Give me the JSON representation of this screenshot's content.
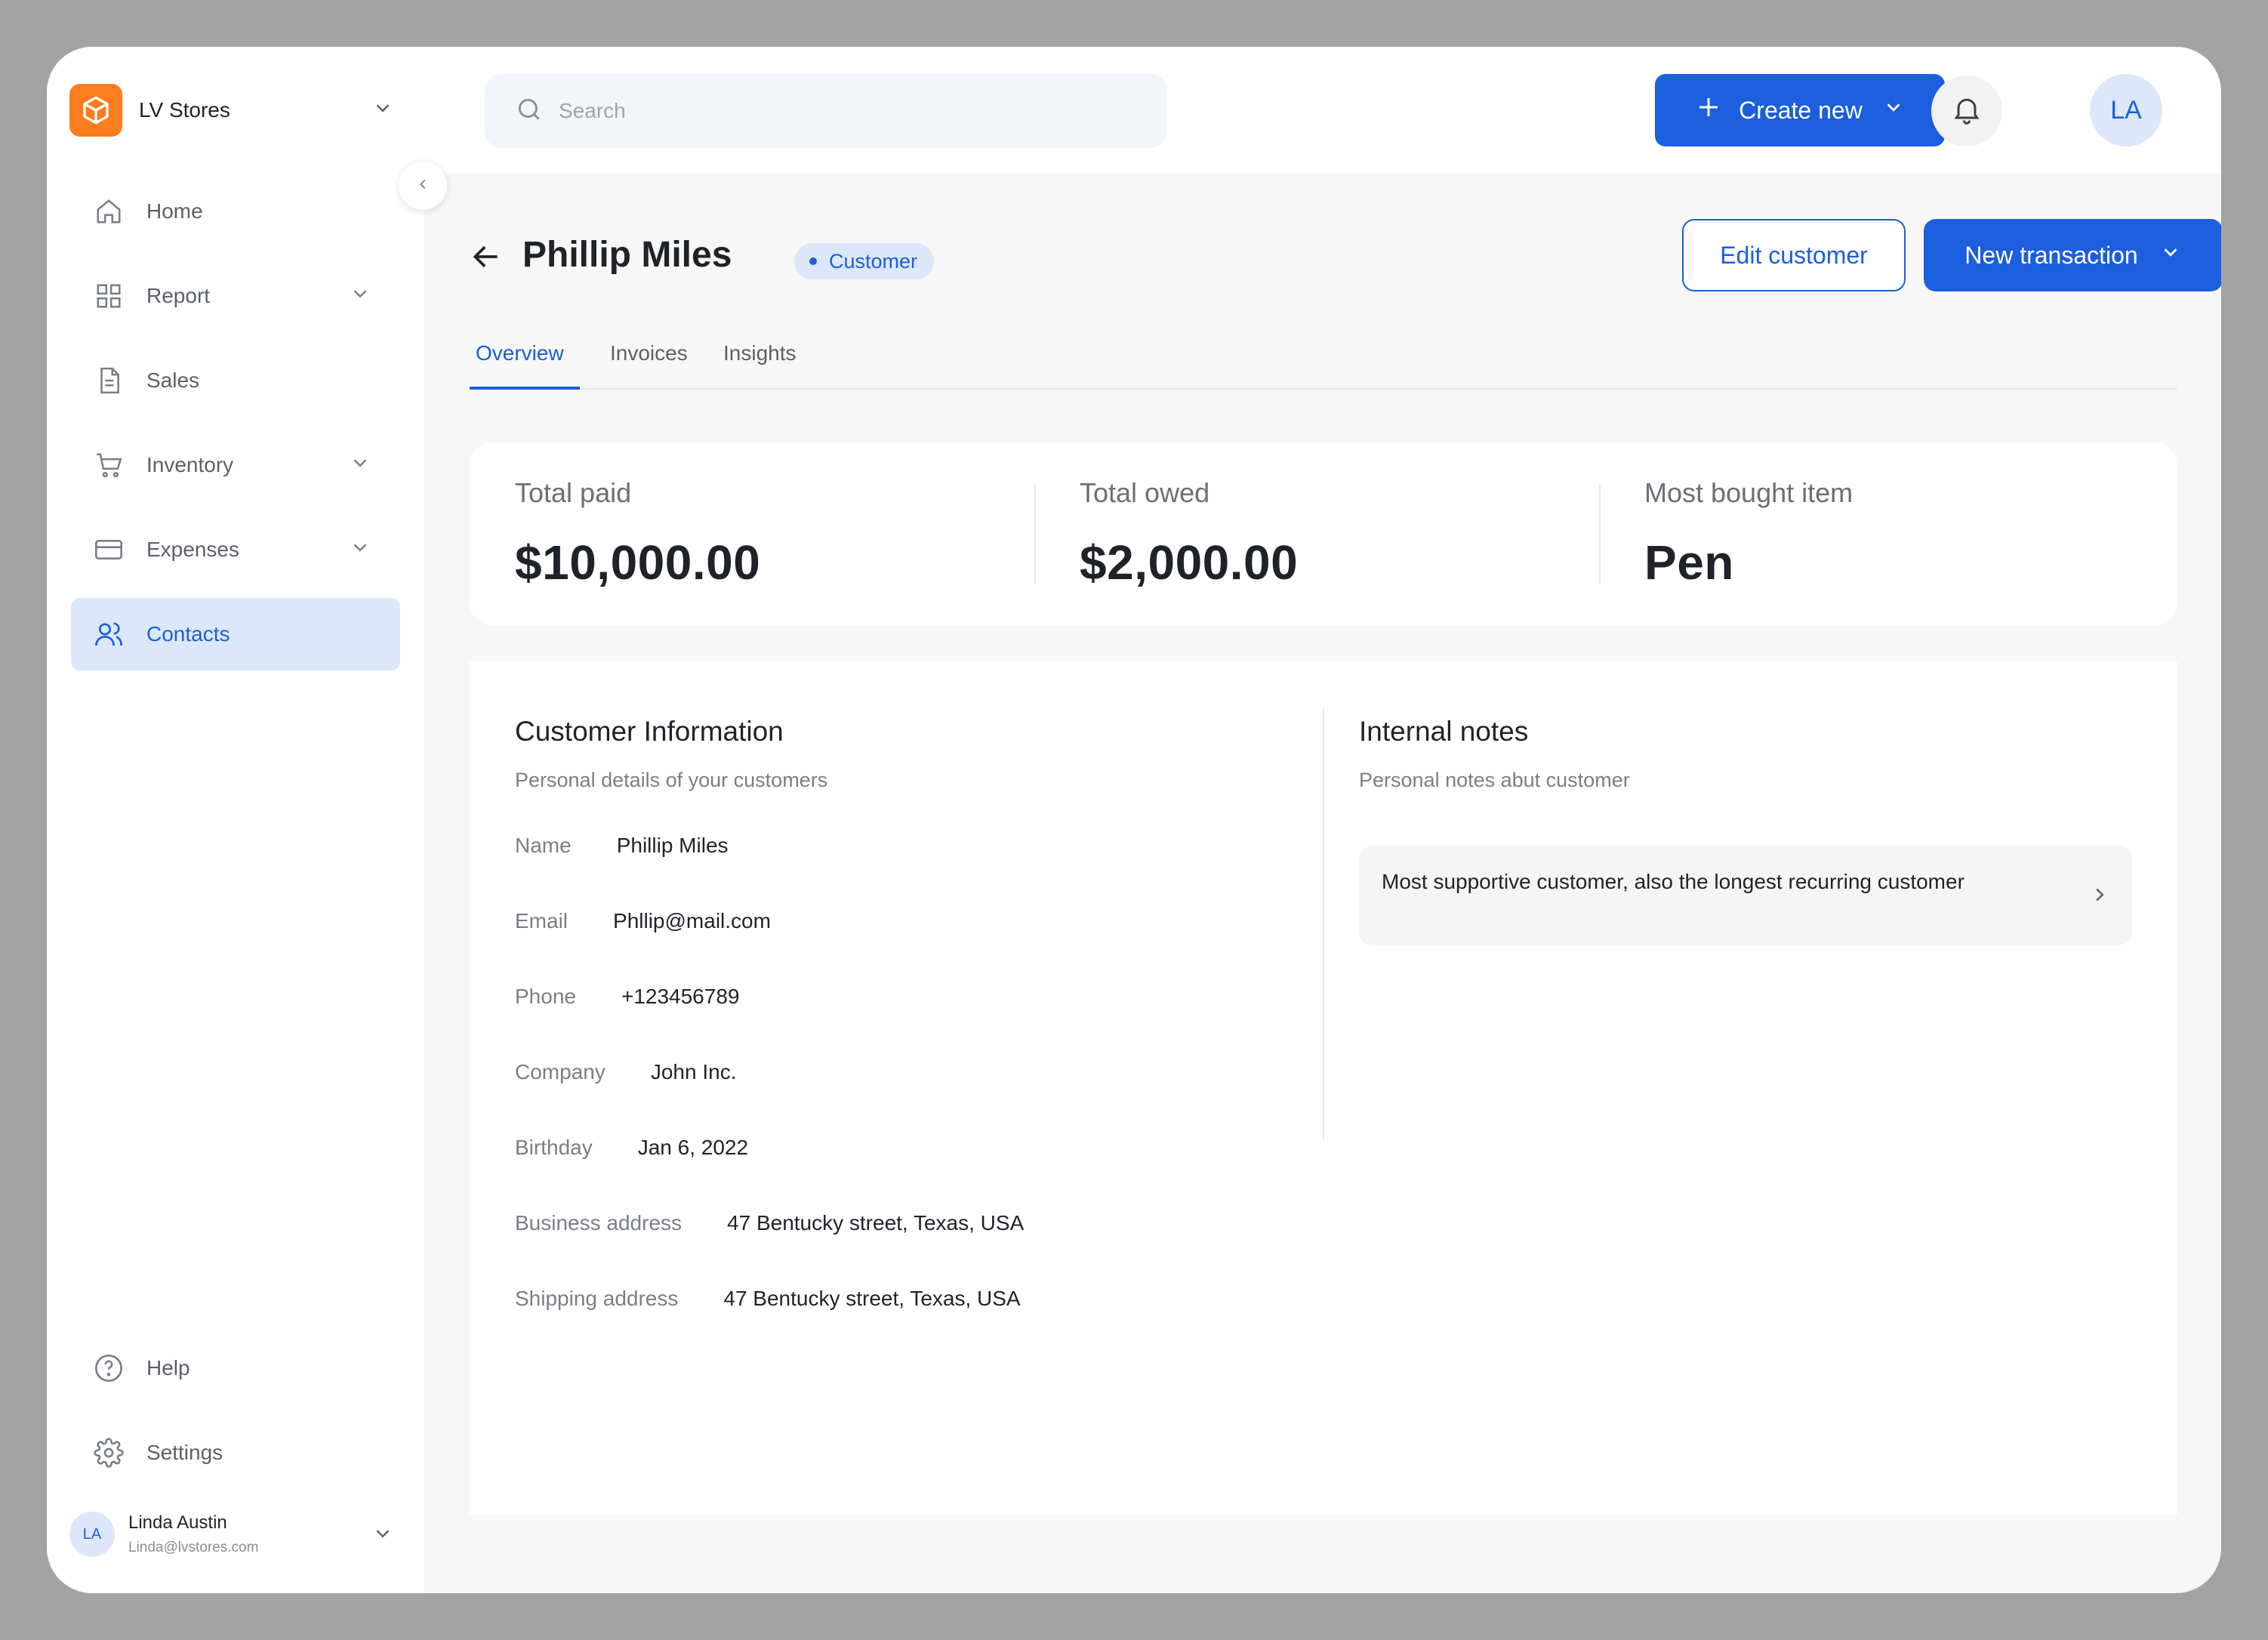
{
  "brand": {
    "name": "LV Stores"
  },
  "sidebar": {
    "items": [
      {
        "label": "Home",
        "icon": "home-icon"
      },
      {
        "label": "Report",
        "icon": "grid-icon",
        "expandable": true
      },
      {
        "label": "Sales",
        "icon": "document-icon"
      },
      {
        "label": "Inventory",
        "icon": "cart-icon",
        "expandable": true
      },
      {
        "label": "Expenses",
        "icon": "credit-card-icon",
        "expandable": true
      },
      {
        "label": "Contacts",
        "icon": "users-icon",
        "active": true
      }
    ],
    "bottom": [
      {
        "label": "Help",
        "icon": "help-circle-icon"
      },
      {
        "label": "Settings",
        "icon": "gear-icon"
      }
    ],
    "user": {
      "initials": "LA",
      "name": "Linda Austin",
      "email": "Linda@lvstores.com"
    }
  },
  "topbar": {
    "search_placeholder": "Search",
    "create_label": "Create new",
    "avatar_initials": "LA"
  },
  "page": {
    "title": "Phillip Miles",
    "badge": "Customer",
    "edit_label": "Edit customer",
    "new_transaction_label": "New transaction",
    "tabs": [
      {
        "label": "Overview",
        "active": true
      },
      {
        "label": "Invoices"
      },
      {
        "label": "Insights"
      }
    ]
  },
  "stats": [
    {
      "label": "Total paid",
      "value": "$10,000.00"
    },
    {
      "label": "Total owed",
      "value": "$2,000.00"
    },
    {
      "label": "Most bought item",
      "value": "Pen"
    }
  ],
  "customer_info": {
    "title": "Customer Information",
    "subtitle": "Personal details of your customers",
    "rows": [
      {
        "key": "Name",
        "value": "Phillip Miles"
      },
      {
        "key": "Email",
        "value": "Phllip@mail.com"
      },
      {
        "key": "Phone",
        "value": "+123456789"
      },
      {
        "key": "Company",
        "value": "John Inc."
      },
      {
        "key": "Birthday",
        "value": "Jan 6, 2022"
      },
      {
        "key": "Business address",
        "value": "47 Bentucky street, Texas, USA"
      },
      {
        "key": "Shipping address",
        "value": "47 Bentucky street, Texas, USA"
      }
    ]
  },
  "internal_notes": {
    "title": "Internal notes",
    "subtitle": "Personal notes abut customer",
    "note": "Most supportive customer, also the longest recurring customer"
  },
  "colors": {
    "accent": "#1b5ede",
    "accent_light": "#dde7fb",
    "brand_orange": "#fb7d1e",
    "bezel": "#a3a3a3"
  }
}
